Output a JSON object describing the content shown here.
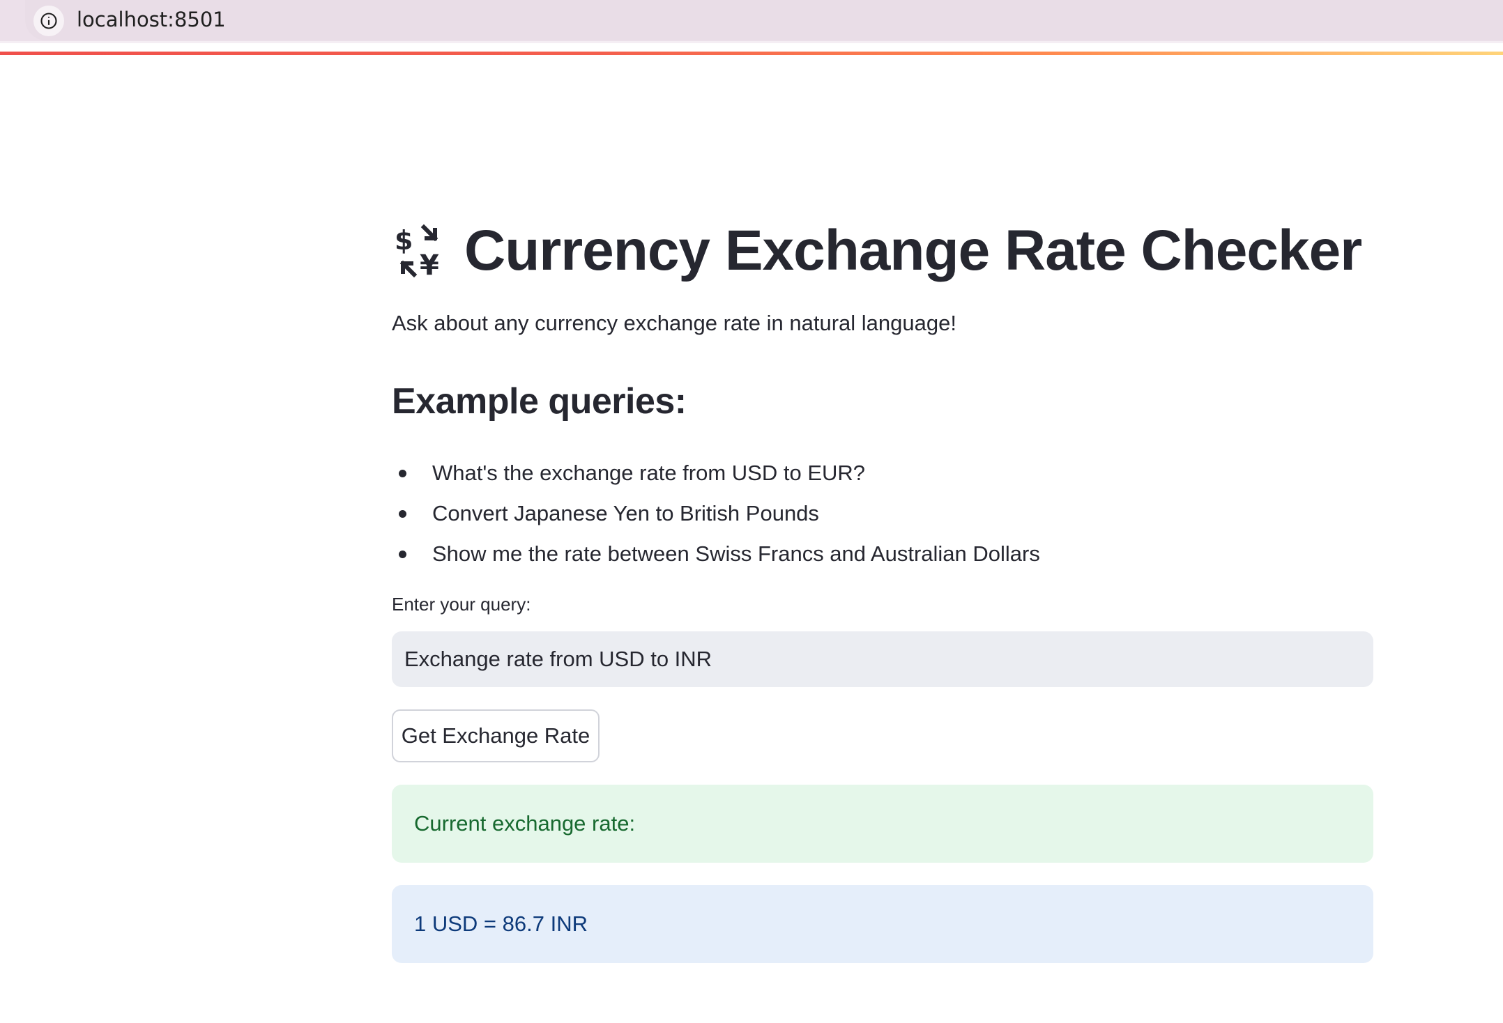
{
  "browser": {
    "url": "localhost:8501",
    "info_icon": "info-circle-icon"
  },
  "app": {
    "title_icon": "currency-exchange-icon",
    "title": "Currency Exchange Rate Checker",
    "subtitle": "Ask about any currency exchange rate in natural language!",
    "examples_heading": "Example queries:",
    "examples": [
      "What's the exchange rate from USD to EUR?",
      "Convert Japanese Yen to British Pounds",
      "Show me the rate between Swiss Francs and Australian Dollars"
    ],
    "query_label": "Enter your query:",
    "query_value": "Exchange rate from USD to INR",
    "button_label": "Get Exchange Rate",
    "success_text": "Current exchange rate:",
    "result_text": "1 USD = 86.7 INR"
  },
  "colors": {
    "accent_start": "#f0504b",
    "accent_end": "#ffd47a",
    "success_bg": "#e5f7ea",
    "success_text": "#17692f",
    "info_bg": "#e5eefa",
    "info_text": "#0d3a7a",
    "input_bg": "#ebedf2"
  }
}
